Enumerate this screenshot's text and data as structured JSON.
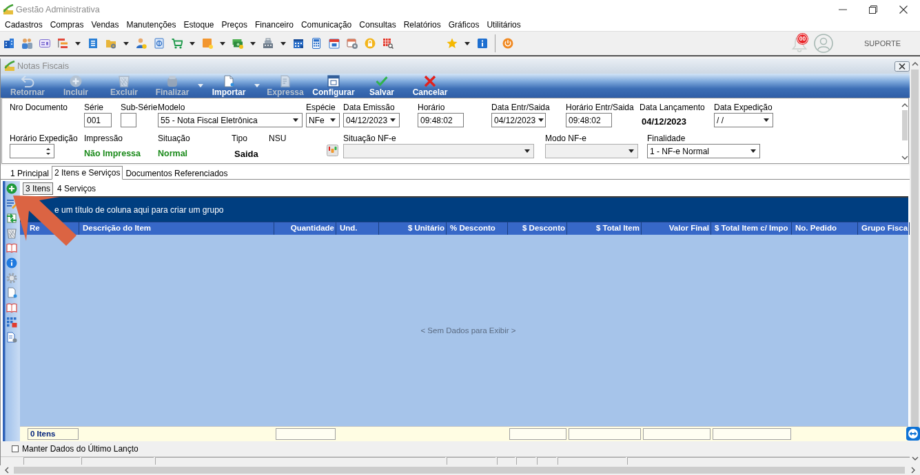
{
  "window": {
    "title": "Gestão Administrativa"
  },
  "menu": [
    "Cadastros",
    "Compras",
    "Vendas",
    "Manutenções",
    "Estoque",
    "Preços",
    "Financeiro",
    "Comunicação",
    "Consultas",
    "Relatórios",
    "Gráficos",
    "Utilitários"
  ],
  "toolbar": {
    "notifications": "00",
    "user": "SUPORTE"
  },
  "document_window": {
    "title": "Notas Fiscais",
    "actions": [
      {
        "label": "Retornar",
        "disabled": true,
        "dropdown": false
      },
      {
        "label": "Incluir",
        "disabled": true,
        "dropdown": false
      },
      {
        "label": "Excluir",
        "disabled": true,
        "dropdown": false
      },
      {
        "label": "Finalizar",
        "disabled": true,
        "dropdown": true
      },
      {
        "label": "Importar",
        "disabled": false,
        "dropdown": true
      },
      {
        "label": "Expressa",
        "disabled": true,
        "dropdown": false
      },
      {
        "label": "Configurar",
        "disabled": false,
        "dropdown": false
      },
      {
        "label": "Salvar",
        "disabled": false,
        "dropdown": false
      },
      {
        "label": "Cancelar",
        "disabled": false,
        "dropdown": false
      }
    ],
    "form": {
      "header_fields": [
        {
          "label": "Nro Documento",
          "kind": "empty",
          "disabled": false
        },
        {
          "label": "Série",
          "kind": "input",
          "value": "001",
          "disabled": false
        },
        {
          "label": "Sub-Série",
          "kind": "input",
          "disabled": false
        },
        {
          "label": "Modelo",
          "kind": "select",
          "value": "55 - Nota Fiscal Eletrônica",
          "disabled": false
        },
        {
          "label": "Espécie",
          "kind": "select",
          "value": "NFe",
          "disabled": false
        },
        {
          "label": "Data Emissão",
          "kind": "select",
          "value": "04/12/2023",
          "disabled": false
        },
        {
          "label": "Horário",
          "kind": "input",
          "value": "09:48:02",
          "disabled": false
        },
        {
          "label": "Data Entr/Saida",
          "kind": "select",
          "value": "04/12/2023",
          "disabled": false
        },
        {
          "label": "Horário Entr/Saida",
          "kind": "input",
          "value": "09:48:02",
          "disabled": false
        },
        {
          "label": "Data Lançamento",
          "kind": "value",
          "value": "04/12/2023",
          "color": "#000000",
          "disabled": false
        },
        {
          "label": "Data Expedição",
          "kind": "select",
          "value": "/ /",
          "disabled": false
        }
      ],
      "status_fields": [
        {
          "label": "Horário Expedição",
          "kind": "spinner",
          "disabled": false
        },
        {
          "label": "Impressão",
          "kind": "value",
          "value": "Não Impressa",
          "color": "#1a8a1a",
          "disabled": false
        },
        {
          "label": "Situação",
          "kind": "value",
          "value": "Normal",
          "color": "#1a8a1a",
          "disabled": false
        },
        {
          "label": "Tipo",
          "kind": "value",
          "value": "Saida",
          "color": "#000000",
          "disabled": false
        },
        {
          "label": "NSU",
          "kind": "button",
          "disabled": false
        },
        {
          "label": "Situação NF-e",
          "kind": "select",
          "disabled": true
        },
        {
          "label": "Modo NF-e",
          "kind": "select",
          "disabled": true
        },
        {
          "label": "Finalidade",
          "kind": "select",
          "value": "1 - NF-e Normal",
          "disabled": false
        }
      ]
    },
    "tabs": [
      {
        "label": "1 Principal",
        "selected": false
      },
      {
        "label": "2 Itens e Serviços",
        "selected": true
      },
      {
        "label": "Documentos Referenciados",
        "selected": false
      }
    ],
    "item_tabs": [
      {
        "label": "3 Itens",
        "selected": true
      },
      {
        "label": "4 Serviços",
        "selected": false
      }
    ],
    "grid": {
      "group_hint": "e um título de coluna aqui para criar um grupo",
      "columns": [
        {
          "label": "Re",
          "kind": "text",
          "footer_box": false
        },
        {
          "label": "Descrição do Item",
          "kind": "text",
          "footer_box": false
        },
        {
          "label": "Quantidade",
          "kind": "number",
          "footer_box": true
        },
        {
          "label": "Und.",
          "kind": "text",
          "footer_box": false
        },
        {
          "label": "$ Unitário",
          "kind": "number",
          "footer_box": false
        },
        {
          "label": "% Desconto",
          "kind": "text",
          "footer_box": false
        },
        {
          "label": "$ Desconto",
          "kind": "number",
          "footer_box": true
        },
        {
          "label": "$ Total Item",
          "kind": "number",
          "footer_box": true
        },
        {
          "label": "Valor Final",
          "kind": "number",
          "footer_box": true
        },
        {
          "label": "$ Total Item c/ Impo",
          "kind": "text",
          "footer_box": true
        },
        {
          "label": "No. Pedido",
          "kind": "text",
          "footer_box": false
        },
        {
          "label": "Grupo Fisca",
          "kind": "text",
          "footer_box": false
        }
      ],
      "empty_text": "< Sem Dados para Exibir >",
      "count": "0 Itens"
    },
    "keep_last_entry": {
      "label": "Manter Dados do Último Lançto",
      "checked": false
    }
  }
}
